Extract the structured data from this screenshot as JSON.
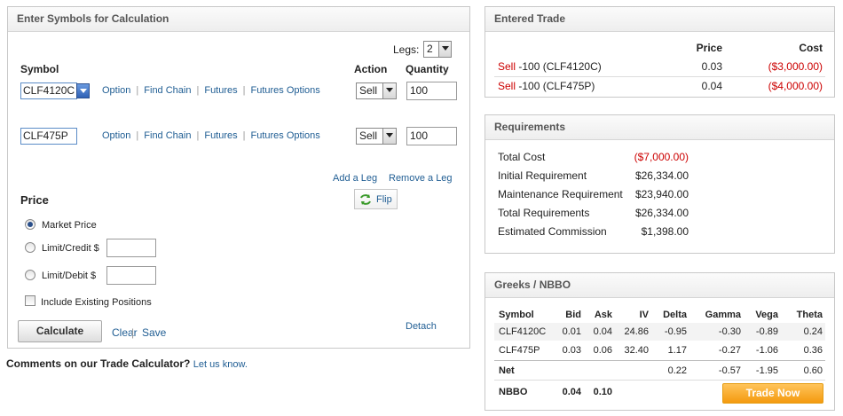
{
  "calc": {
    "title": "Enter Symbols for Calculation",
    "legs_label": "Legs:",
    "legs_value": "2",
    "headers": {
      "symbol": "Symbol",
      "action": "Action",
      "quantity": "Quantity"
    },
    "legs": [
      {
        "symbol": "CLF4120C",
        "action": "Sell",
        "quantity": "100",
        "links": [
          "Option",
          "Find Chain",
          "Futures",
          "Futures Options"
        ]
      },
      {
        "symbol": "CLF475P",
        "action": "Sell",
        "quantity": "100",
        "links": [
          "Option",
          "Find Chain",
          "Futures",
          "Futures Options"
        ]
      }
    ],
    "add_leg": "Add a Leg",
    "remove_leg": "Remove a Leg",
    "flip": "Flip",
    "price_label": "Price",
    "price_options": [
      "Market Price",
      "Limit/Credit $",
      "Limit/Debit $"
    ],
    "include_existing": "Include Existing Positions",
    "calculate": "Calculate",
    "clear": "Clear",
    "save": "Save",
    "detach": "Detach"
  },
  "footer": {
    "comments": "Comments on our Trade Calculator?",
    "let_us_know": "Let us know."
  },
  "entered_trade": {
    "title": "Entered Trade",
    "headers": {
      "price": "Price",
      "cost": "Cost"
    },
    "rows": [
      {
        "action": "Sell",
        "desc": "-100 (CLF4120C)",
        "price": "0.03",
        "cost": "($3,000.00)"
      },
      {
        "action": "Sell",
        "desc": "-100 (CLF475P)",
        "price": "0.04",
        "cost": "($4,000.00)"
      }
    ]
  },
  "requirements": {
    "title": "Requirements",
    "rows": [
      {
        "label": "Total Cost",
        "value": "($7,000.00)",
        "negative": true
      },
      {
        "label": "Initial Requirement",
        "value": "$26,334.00",
        "negative": false
      },
      {
        "label": "Maintenance Requirement",
        "value": "$23,940.00",
        "negative": false
      },
      {
        "label": "Total Requirements",
        "value": "$26,334.00",
        "negative": false
      },
      {
        "label": "Estimated Commission",
        "value": "$1,398.00",
        "negative": false
      }
    ]
  },
  "greeks": {
    "title": "Greeks / NBBO",
    "headers": [
      "Symbol",
      "Bid",
      "Ask",
      "IV",
      "Delta",
      "Gamma",
      "Vega",
      "Theta"
    ],
    "rows": [
      [
        "CLF4120C",
        "0.01",
        "0.04",
        "24.86",
        "-0.95",
        "-0.30",
        "-0.89",
        "0.24"
      ],
      [
        "CLF475P",
        "0.03",
        "0.06",
        "32.40",
        "1.17",
        "-0.27",
        "-1.06",
        "0.36"
      ]
    ],
    "net": {
      "label": "Net",
      "delta": "0.22",
      "gamma": "-0.57",
      "vega": "-1.95",
      "theta": "0.60"
    },
    "nbbo": {
      "label": "NBBO",
      "bid": "0.04",
      "ask": "0.10"
    },
    "trade_now": "Trade Now"
  },
  "colors": {
    "link": "#1f5d93",
    "negative": "#cc0000",
    "trade_button": "#f49a0f"
  }
}
